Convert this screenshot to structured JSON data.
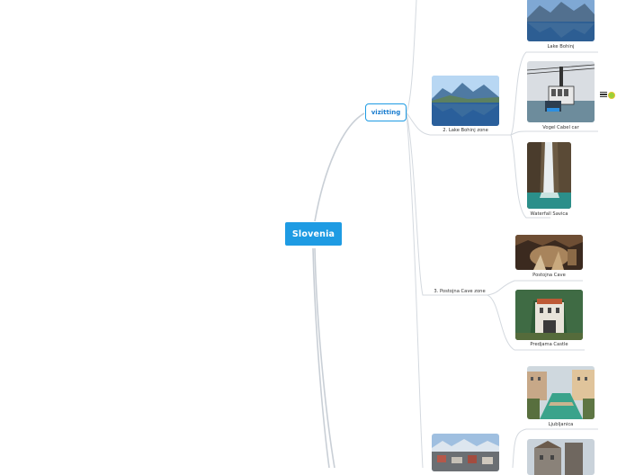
{
  "root": {
    "label": "Slovenia"
  },
  "main_topic": {
    "label": "vizitting"
  },
  "subtopics": {
    "bohinj_zone": "2. Lake Bohinj zone",
    "postojna_zone": "3. Postojna Cave zone"
  },
  "images": {
    "lake_bohinj": "Lake Bohinj",
    "vogel_cable_car": "Vogel Cabel car",
    "waterfall_savica": "Waterfall Savica",
    "postojna_cave": "Postojna Cave",
    "predjama_castle": "Predjama Castle",
    "ljubljanica": "Ljubljanica"
  },
  "colors": {
    "accent": "#1e9be3",
    "connector": "#c9cfd6",
    "main_text": "#1e7fd0"
  },
  "icons": [
    "menu-icon",
    "sticker-icon"
  ]
}
